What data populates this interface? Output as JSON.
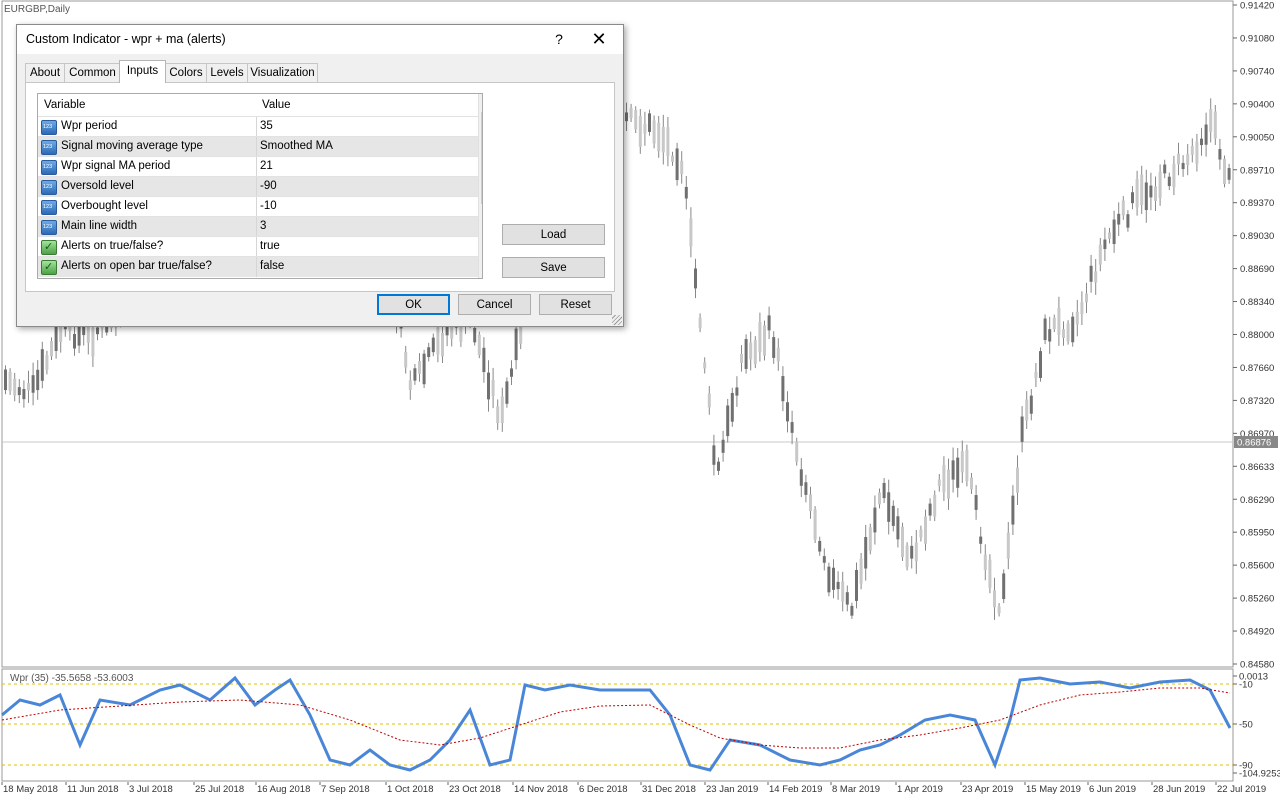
{
  "chart": {
    "symbol_label": "EURGBP,Daily",
    "price_ticks": [
      "0.91420",
      "0.91080",
      "0.90740",
      "0.90400",
      "0.90050",
      "0.89710",
      "0.89370",
      "0.89030",
      "0.88690",
      "0.88340",
      "0.88000",
      "0.87660",
      "0.87320",
      "0.86970",
      "0.86633",
      "0.86290",
      "0.85950",
      "0.85600",
      "0.85260",
      "0.84920",
      "0.84580"
    ],
    "current_price": "0.86876",
    "date_ticks": [
      "18 May 2018",
      "11 Jun 2018",
      "3 Jul 2018",
      "25 Jul 2018",
      "16 Aug 2018",
      "7 Sep 2018",
      "1 Oct 2018",
      "23 Oct 2018",
      "14 Nov 2018",
      "6 Dec 2018",
      "31 Dec 2018",
      "23 Jan 2019",
      "14 Feb 2019",
      "8 Mar 2019",
      "1 Apr 2019",
      "23 Apr 2019",
      "15 May 2019",
      "6 Jun 2019",
      "28 Jun 2019",
      "22 Jul 2019"
    ],
    "indicator_label": "Wpr (35) -35.5658 -53.6003",
    "indicator_ticks": [
      "0.0013",
      "-10",
      "-50",
      "-90",
      "-104.9253"
    ],
    "colors": {
      "wpr_line": "#4a86d8",
      "ma_line": "#c00000",
      "level_line": "#e0c000",
      "candle": "#888888",
      "current_price_bg": "#888888"
    }
  },
  "dialog": {
    "title": "Custom Indicator - wpr + ma (alerts)",
    "help_label": "?",
    "close_label": "✕",
    "tabs": [
      {
        "label": "About",
        "active": false
      },
      {
        "label": "Common",
        "active": false
      },
      {
        "label": "Inputs",
        "active": true
      },
      {
        "label": "Colors",
        "active": false
      },
      {
        "label": "Levels",
        "active": false
      },
      {
        "label": "Visualization",
        "active": false
      }
    ],
    "grid_headers": {
      "variable": "Variable",
      "value": "Value"
    },
    "params": [
      {
        "name": "Wpr period",
        "value": "35",
        "icon": "number-icon"
      },
      {
        "name": "Signal moving average type",
        "value": "Smoothed MA",
        "icon": "number-icon"
      },
      {
        "name": "Wpr signal MA period",
        "value": "21",
        "icon": "number-icon"
      },
      {
        "name": "Oversold level",
        "value": "-90",
        "icon": "number-icon"
      },
      {
        "name": "Overbought level",
        "value": "-10",
        "icon": "number-icon"
      },
      {
        "name": "Main line width",
        "value": "3",
        "icon": "number-icon"
      },
      {
        "name": "Alerts on true/false?",
        "value": "true",
        "icon": "boolean-icon"
      },
      {
        "name": "Alerts on open bar true/false?",
        "value": "false",
        "icon": "boolean-icon"
      }
    ],
    "buttons": {
      "load": "Load",
      "save": "Save",
      "ok": "OK",
      "cancel": "Cancel",
      "reset": "Reset"
    },
    "number_icon_text": "123",
    "bool_icon_text": "✓"
  }
}
